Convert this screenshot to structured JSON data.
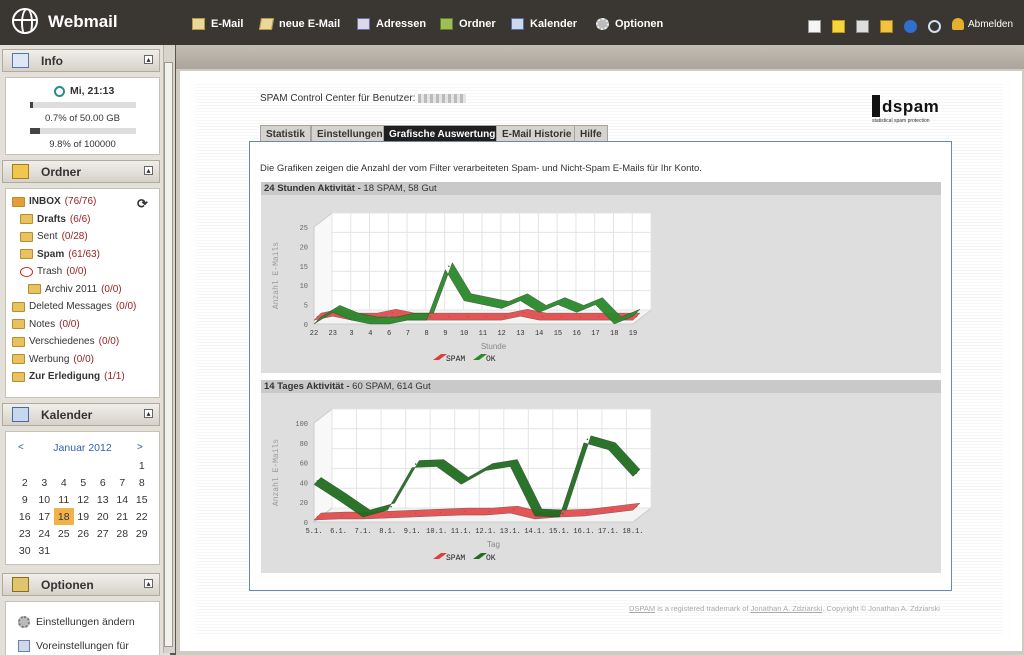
{
  "app": {
    "title": "Webmail"
  },
  "nav": [
    {
      "label": "E-Mail",
      "icon": "mail-icon"
    },
    {
      "label": "neue E-Mail",
      "icon": "compose-icon"
    },
    {
      "label": "Adressen",
      "icon": "address-book-icon"
    },
    {
      "label": "Ordner",
      "icon": "folder-icon"
    },
    {
      "label": "Kalender",
      "icon": "calendar-icon"
    },
    {
      "label": "Optionen",
      "icon": "gear-icon"
    }
  ],
  "toolbar": {
    "logout_label": "Abmelden"
  },
  "sidebar": {
    "info": {
      "title": "Info",
      "time": "Mi, 21:13",
      "storage": {
        "text": "0.7% of 50.00 GB",
        "fraction": 0.007
      },
      "messages": {
        "text": "9.8% of 100000",
        "fraction": 0.098
      }
    },
    "folders": {
      "title": "Ordner",
      "items": [
        {
          "name": "INBOX",
          "count": "(76/76)",
          "bold": true,
          "indent": 0
        },
        {
          "name": "Drafts",
          "count": "(6/6)",
          "bold": true,
          "indent": 1
        },
        {
          "name": "Sent",
          "count": "(0/28)",
          "bold": false,
          "indent": 1
        },
        {
          "name": "Spam",
          "count": "(61/63)",
          "bold": true,
          "indent": 1
        },
        {
          "name": "Trash",
          "count": "(0/0)",
          "bold": false,
          "indent": 1
        },
        {
          "name": "Archiv 2011",
          "count": "(0/0)",
          "bold": false,
          "indent": 2
        },
        {
          "name": "Deleted Messages",
          "count": "(0/0)",
          "bold": false,
          "indent": 0
        },
        {
          "name": "Notes",
          "count": "(0/0)",
          "bold": false,
          "indent": 0
        },
        {
          "name": "Verschiedenes",
          "count": "(0/0)",
          "bold": false,
          "indent": 0
        },
        {
          "name": "Werbung",
          "count": "(0/0)",
          "bold": false,
          "indent": 0
        },
        {
          "name": "Zur Erledigung",
          "count": "(1/1)",
          "bold": true,
          "indent": 0
        }
      ]
    },
    "calendar": {
      "title": "Kalender",
      "month": "Januar 2012",
      "prev": "<",
      "next": ">",
      "weeks": [
        [
          "",
          "",
          "",
          "",
          "",
          "",
          "1"
        ],
        [
          "2",
          "3",
          "4",
          "5",
          "6",
          "7",
          "8"
        ],
        [
          "9",
          "10",
          "11",
          "12",
          "13",
          "14",
          "15"
        ],
        [
          "16",
          "17",
          "18",
          "19",
          "20",
          "21",
          "22"
        ],
        [
          "23",
          "24",
          "25",
          "26",
          "27",
          "28",
          "29"
        ],
        [
          "30",
          "31",
          "",
          "",
          "",
          "",
          ""
        ]
      ],
      "today": "18"
    },
    "options": {
      "title": "Optionen",
      "items": [
        "Einstellungen ändern",
        "Voreinstellungen für"
      ]
    }
  },
  "spam": {
    "title": "SPAM Control Center für Benutzer:",
    "logo": "dspam",
    "logo_tagline": "statistical spam protection",
    "tabs": [
      "Statistik",
      "Einstellungen",
      "Grafische Auswertung",
      "E-Mail Historie",
      "Hilfe"
    ],
    "active_tab": "Grafische Auswertung",
    "intro": "Die Grafiken zeigen die Anzahl der vom Filter verarbeiteten Spam- und Nicht-Spam E-Mails für Ihr Konto.",
    "footer_link1": "DSPAM",
    "footer_text1": " is a registered trademark of ",
    "footer_link2": "Jonathan A. Zdziarski",
    "footer_text2": ". Copyright © Jonathan A. Zdziarski"
  },
  "chart_data": [
    {
      "type": "area",
      "title": "24 Stunden Aktivität -",
      "summary": "18 SPAM,  58 Gut",
      "xlabel": "Stunde",
      "ylabel": "Anzahl E-Mails",
      "categories": [
        "22",
        "23",
        "3",
        "4",
        "6",
        "7",
        "8",
        "9",
        "10",
        "11",
        "12",
        "13",
        "14",
        "15",
        "16",
        "17",
        "18",
        "19"
      ],
      "ylim": [
        0,
        25
      ],
      "yticks": [
        "0",
        "5",
        "10",
        "15",
        "20",
        "25"
      ],
      "series": [
        {
          "name": "SPAM",
          "color": "#e23b3b",
          "values": [
            1,
            2,
            1,
            1,
            2,
            1,
            1,
            1,
            1,
            1,
            1,
            2,
            1,
            1,
            1,
            1,
            1,
            1
          ]
        },
        {
          "name": "OK",
          "color": "#2a8a2a",
          "values": [
            0,
            3,
            1,
            0,
            0,
            1,
            1,
            14,
            6,
            5,
            4,
            6,
            3,
            5,
            3,
            5,
            0,
            2
          ]
        }
      ]
    },
    {
      "type": "area",
      "title": "14 Tages Aktivität -",
      "summary": "60 SPAM,  614 Gut",
      "xlabel": "Tag",
      "ylabel": "Anzahl E-Mails",
      "categories": [
        "5.1.",
        "6.1.",
        "7.1.",
        "8.1.",
        "9.1.",
        "10.1.",
        "11.1.",
        "12.1.",
        "13.1.",
        "14.1.",
        "15.1.",
        "16.1.",
        "17.1.",
        "18.1."
      ],
      "ylim": [
        0,
        100
      ],
      "yticks": [
        "0",
        "20",
        "40",
        "60",
        "80",
        "100"
      ],
      "series": [
        {
          "name": "SPAM",
          "color": "#e23b3b",
          "values": [
            2,
            3,
            3,
            4,
            5,
            6,
            7,
            7,
            9,
            3,
            5,
            6,
            9,
            12
          ]
        },
        {
          "name": "OK",
          "color": "#1f6e1f",
          "values": [
            38,
            22,
            5,
            12,
            55,
            56,
            38,
            52,
            56,
            6,
            5,
            80,
            73,
            46
          ]
        }
      ]
    }
  ]
}
